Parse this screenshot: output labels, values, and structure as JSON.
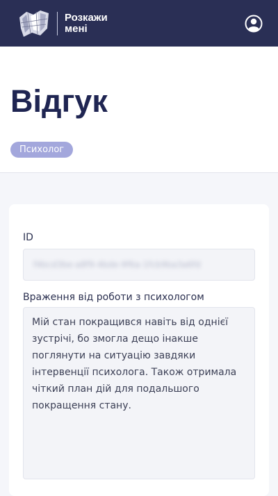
{
  "header": {
    "brand": "Розкажи мені",
    "logo_icon": "map-logo-icon",
    "profile_icon": "user-profile-icon"
  },
  "page": {
    "title": "Відгук",
    "role_badge": "Психолог"
  },
  "form": {
    "id_label": "ID",
    "id_value": "f4bcd3be-a8f9-4bde-9f6a-1fcb9ba3a6fd",
    "feedback_label": "Враження від роботи з психологом",
    "feedback_value": "Мій стан покращився навіть від однієї зустрічі, бо змогла дещо інакше поглянути на ситуацію завдяки інтервенції психолога. Також отримала чіткий план дій для подальшого покращення стану."
  },
  "colors": {
    "header_bg": "#2a2f55",
    "title": "#1f2552",
    "badge_bg": "#a3a7dc",
    "page_bg": "#f5f6fa"
  }
}
